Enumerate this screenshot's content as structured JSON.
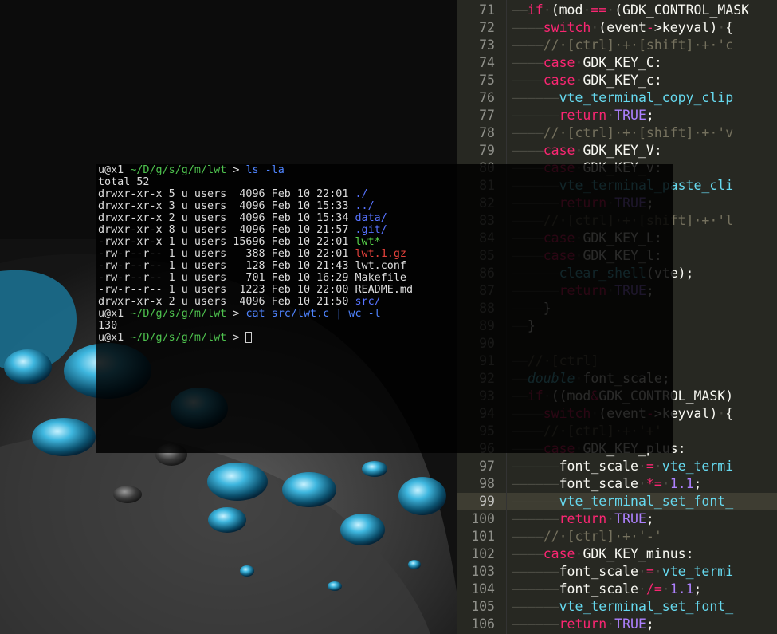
{
  "terminal": {
    "prompt_user": "u@x1",
    "prompt_path": "~/D/g/s/g/m/lwt",
    "prompt_symbol": ">",
    "command1": "ls -la",
    "total": "total 52",
    "listing": [
      {
        "perm": "drwxr-xr-x",
        "links": "5",
        "owner": "u",
        "group": "users",
        "size": " 4096",
        "date": "Feb 10 22:01",
        "name": "./",
        "kind": "dir"
      },
      {
        "perm": "drwxr-xr-x",
        "links": "3",
        "owner": "u",
        "group": "users",
        "size": " 4096",
        "date": "Feb 10 15:33",
        "name": "../",
        "kind": "dir"
      },
      {
        "perm": "drwxr-xr-x",
        "links": "2",
        "owner": "u",
        "group": "users",
        "size": " 4096",
        "date": "Feb 10 15:34",
        "name": "data/",
        "kind": "dir"
      },
      {
        "perm": "drwxr-xr-x",
        "links": "8",
        "owner": "u",
        "group": "users",
        "size": " 4096",
        "date": "Feb 10 21:57",
        "name": ".git/",
        "kind": "dir"
      },
      {
        "perm": "-rwxr-xr-x",
        "links": "1",
        "owner": "u",
        "group": "users",
        "size": "15696",
        "date": "Feb 10 22:01",
        "name": "lwt*",
        "kind": "exe"
      },
      {
        "perm": "-rw-r--r--",
        "links": "1",
        "owner": "u",
        "group": "users",
        "size": "  388",
        "date": "Feb 10 22:01",
        "name": "lwt.1.gz",
        "kind": "archive"
      },
      {
        "perm": "-rw-r--r--",
        "links": "1",
        "owner": "u",
        "group": "users",
        "size": "  128",
        "date": "Feb 10 21:43",
        "name": "lwt.conf",
        "kind": "file"
      },
      {
        "perm": "-rw-r--r--",
        "links": "1",
        "owner": "u",
        "group": "users",
        "size": "  701",
        "date": "Feb 10 16:29",
        "name": "Makefile",
        "kind": "file"
      },
      {
        "perm": "-rw-r--r--",
        "links": "1",
        "owner": "u",
        "group": "users",
        "size": " 1223",
        "date": "Feb 10 22:00",
        "name": "README.md",
        "kind": "file"
      },
      {
        "perm": "drwxr-xr-x",
        "links": "2",
        "owner": "u",
        "group": "users",
        "size": " 4096",
        "date": "Feb 10 21:50",
        "name": "src/",
        "kind": "dir"
      }
    ],
    "command2": "cat src/lwt.c | wc -l",
    "output2": "130"
  },
  "editor": {
    "current_line": "99",
    "lines": [
      {
        "n": "71",
        "t": "——if (mod == (GDK_CONTROL_MASK"
      },
      {
        "n": "72",
        "t": "————switch (event->keyval) {"
      },
      {
        "n": "73",
        "t": "————// [ctrl] + [shift] + 'c"
      },
      {
        "n": "74",
        "t": "————case GDK_KEY_C:"
      },
      {
        "n": "75",
        "t": "————case GDK_KEY_c:"
      },
      {
        "n": "76",
        "t": "——————vte_terminal_copy_clip"
      },
      {
        "n": "77",
        "t": "——————return TRUE;"
      },
      {
        "n": "78",
        "t": "————// [ctrl] + [shift] + 'v"
      },
      {
        "n": "79",
        "t": "————case GDK_KEY_V:"
      },
      {
        "n": "80",
        "t": "————case GDK_KEY_v:"
      },
      {
        "n": "81",
        "t": "——————vte_terminal_paste_cli"
      },
      {
        "n": "82",
        "t": "——————return TRUE;"
      },
      {
        "n": "83",
        "t": "————// [ctrl] + [shift] + 'l"
      },
      {
        "n": "84",
        "t": "————case GDK_KEY_L:"
      },
      {
        "n": "85",
        "t": "————case GDK_KEY_l:"
      },
      {
        "n": "86",
        "t": "——————clear_shell(vte);"
      },
      {
        "n": "87",
        "t": "——————return TRUE;"
      },
      {
        "n": "88",
        "t": "————}"
      },
      {
        "n": "89",
        "t": "——}"
      },
      {
        "n": "90",
        "t": ""
      },
      {
        "n": "91",
        "t": "——// [ctrl]"
      },
      {
        "n": "92",
        "t": "——double font_scale;"
      },
      {
        "n": "93",
        "t": "——if ((mod&GDK_CONTROL_MASK)"
      },
      {
        "n": "94",
        "t": "————switch (event->keyval) {"
      },
      {
        "n": "95",
        "t": "————// [ctrl] + '+'"
      },
      {
        "n": "96",
        "t": "————case GDK_KEY_plus:"
      },
      {
        "n": "97",
        "t": "——————font_scale = vte_termi"
      },
      {
        "n": "98",
        "t": "——————font_scale *= 1.1;"
      },
      {
        "n": "99",
        "t": "——————vte_terminal_set_font_"
      },
      {
        "n": "100",
        "t": "——————return TRUE;"
      },
      {
        "n": "101",
        "t": "————// [ctrl] + '-'"
      },
      {
        "n": "102",
        "t": "————case GDK_KEY_minus:"
      },
      {
        "n": "103",
        "t": "——————font_scale = vte_termi"
      },
      {
        "n": "104",
        "t": "——————font_scale /= 1.1;"
      },
      {
        "n": "105",
        "t": "——————vte_terminal_set_font_"
      },
      {
        "n": "106",
        "t": "——————return TRUE;"
      }
    ]
  },
  "colors": {
    "editor_bg": "#272822",
    "keyword": "#f92672",
    "function": "#66d9ef",
    "number": "#ae81ff",
    "string": "#e6db74",
    "comment": "#75715e",
    "term_path": "#4ec24e",
    "term_dir": "#5773ff",
    "term_exe": "#58d34a",
    "term_archive": "#e2413b"
  }
}
